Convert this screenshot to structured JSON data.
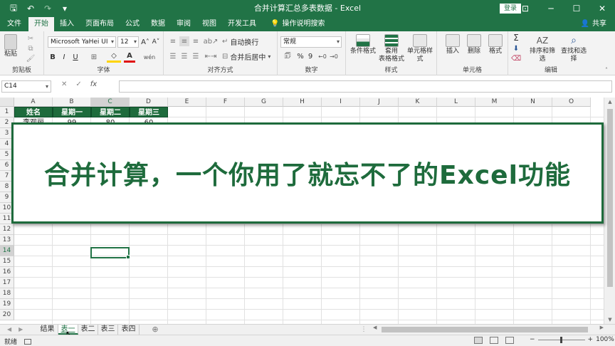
{
  "window": {
    "title": "合并计算汇总多表数据  -  Excel",
    "login_label": "登录",
    "qat": {
      "save": "🖫",
      "undo": "↶",
      "redo": "↷",
      "customize": "▾"
    },
    "controls": {
      "ribbon_options": "⊡",
      "minimize": "─",
      "maximize": "☐",
      "close": "✕"
    }
  },
  "ribbon_tabs": [
    "文件",
    "开始",
    "插入",
    "页面布局",
    "公式",
    "数据",
    "审阅",
    "视图",
    "开发工具"
  ],
  "active_tab": "开始",
  "tell_me": "操作说明搜索",
  "share": "共享",
  "ribbon": {
    "clipboard": {
      "label": "剪贴板",
      "paste": "粘贴"
    },
    "font": {
      "label": "字体",
      "font_name": "Microsoft YaHei UI",
      "font_size": "12",
      "bold": "B",
      "italic": "I",
      "underline": "U",
      "grow": "A˄",
      "shrink": "A˅",
      "font_color_letter": "A",
      "wen": "wén"
    },
    "alignment": {
      "label": "对齐方式",
      "wrap": "自动换行",
      "merge": "合并后居中"
    },
    "number": {
      "label": "数字",
      "format": "常规",
      "percent": "%",
      "comma": "9"
    },
    "styles": {
      "label": "样式",
      "conditional": "条件格式",
      "table_line1": "套用",
      "table_line2": "表格格式",
      "cell_styles": "单元格样式"
    },
    "cells": {
      "label": "单元格",
      "insert": "插入",
      "delete": "删除",
      "format": "格式"
    },
    "editing": {
      "label": "编辑",
      "sort": "排序和筛选",
      "find": "查找和选择",
      "sum": "Σ"
    }
  },
  "formula_bar": {
    "name_box": "C14",
    "cancel": "✕",
    "enter": "✓",
    "fx": "fx",
    "value": ""
  },
  "grid": {
    "columns": [
      "A",
      "B",
      "C",
      "D",
      "E",
      "F",
      "G",
      "H",
      "I",
      "J",
      "K",
      "L",
      "M",
      "N",
      "O"
    ],
    "rows": [
      "1",
      "2",
      "3",
      "4",
      "5",
      "6",
      "7",
      "8",
      "9",
      "10",
      "11",
      "12",
      "13",
      "14",
      "15",
      "16",
      "17",
      "18",
      "19",
      "20"
    ],
    "selected_column": "C",
    "selected_row": "14",
    "header_cells": [
      "姓名",
      "星期一",
      "星期二",
      "星期三"
    ],
    "row2_cells": [
      "李观丽",
      "99",
      "80",
      "60"
    ]
  },
  "banner": {
    "text": "合并计算，一个你用了就忘不了的Excel功能"
  },
  "sheets": [
    "结果",
    "表一",
    "表二",
    "表三",
    "表四"
  ],
  "active_sheet": "表一",
  "add_sheet": "⊕",
  "status": {
    "ready": "就绪",
    "zoom": "100%",
    "minus": "−",
    "plus": "+"
  }
}
